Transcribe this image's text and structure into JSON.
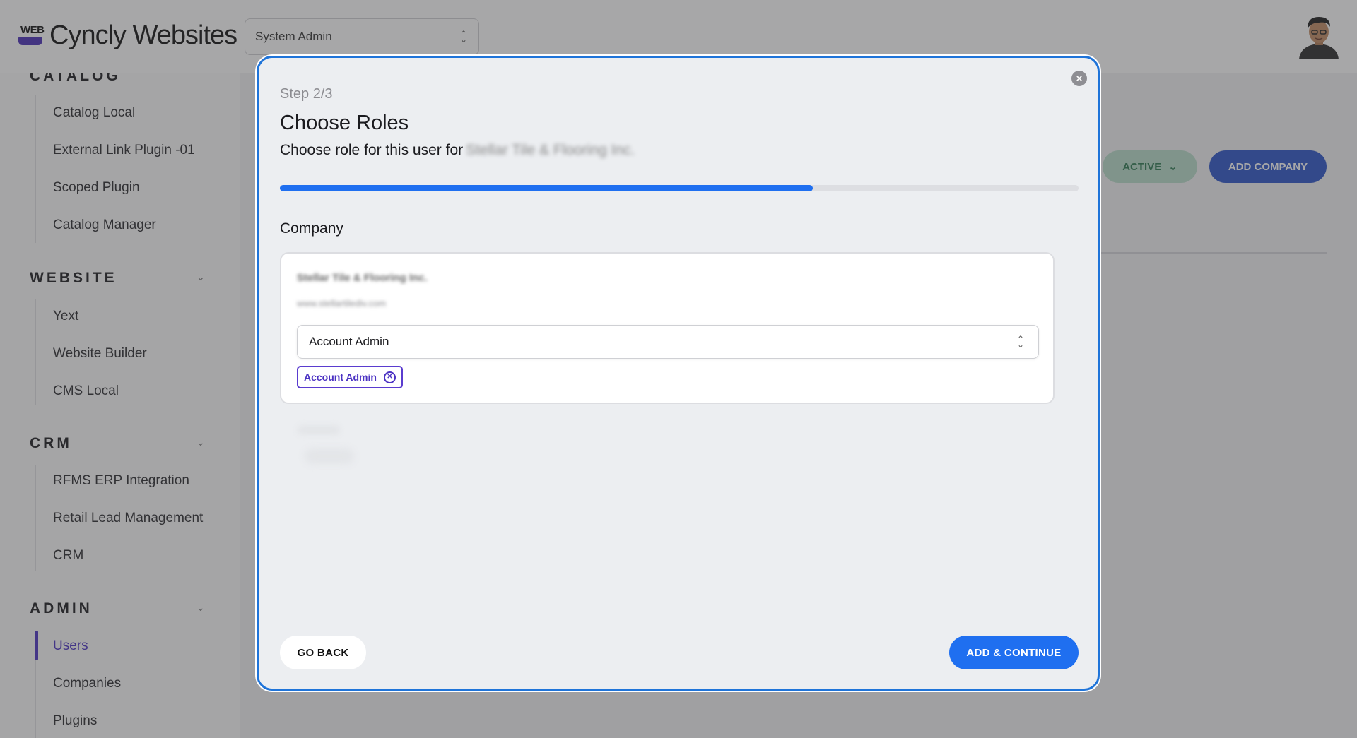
{
  "app": {
    "logo_small": "WEB",
    "logo_title": "Cyncly Websites",
    "role_selector": "System Admin"
  },
  "sidebar": {
    "catalog": {
      "heading": "CATALOG",
      "items": [
        "Catalog Local",
        "External Link Plugin -01",
        "Scoped Plugin",
        "Catalog Manager"
      ]
    },
    "website": {
      "heading": "WEBSITE",
      "items": [
        "Yext",
        "Website Builder",
        "CMS Local"
      ]
    },
    "crm": {
      "heading": "CRM",
      "items": [
        "RFMS ERP Integration",
        "Retail Lead Management",
        "CRM"
      ]
    },
    "admin": {
      "heading": "ADMIN",
      "items": [
        "Users",
        "Companies",
        "Plugins"
      ],
      "active": "Users"
    }
  },
  "content": {
    "status_filter": "ACTIVE",
    "add_company": "ADD COMPANY"
  },
  "modal": {
    "step": "Step 2/3",
    "title": "Choose Roles",
    "subtitle": "Choose role for this user for",
    "subtitle_company": "Stellar Tile & Flooring Inc.",
    "progress": 0.667,
    "section_label": "Company",
    "company": {
      "name": "Stellar Tile & Flooring Inc.",
      "url": "www.stellartilediv.com",
      "role_select": "Account Admin",
      "chips": [
        "Account Admin"
      ]
    },
    "go_back": "GO BACK",
    "add_continue": "ADD & CONTINUE"
  },
  "colors": {
    "accent": "#1f6ff0",
    "brand_purple": "#4b32c3",
    "active_green": "#2f7a52"
  }
}
